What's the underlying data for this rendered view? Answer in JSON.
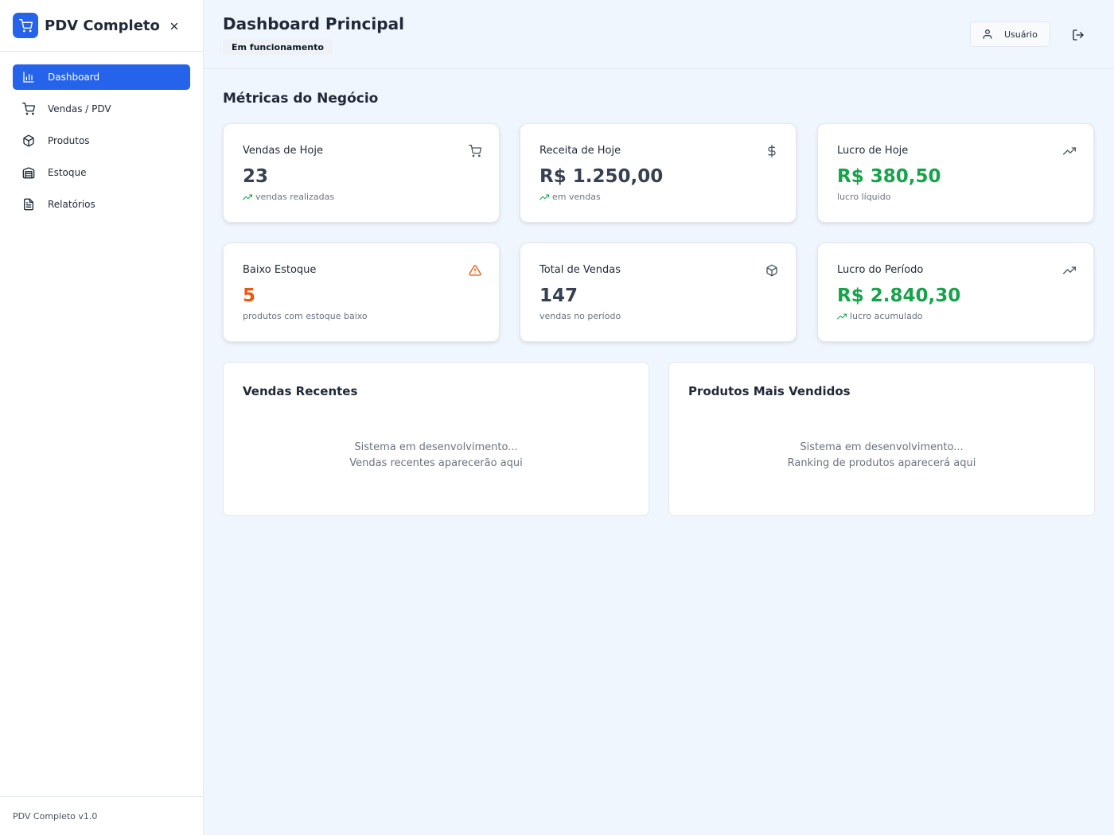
{
  "sidebar": {
    "brand": "PDV Completo",
    "items": [
      {
        "label": "Dashboard",
        "icon": "bar-chart-icon",
        "active": true
      },
      {
        "label": "Vendas / PDV",
        "icon": "cart-icon"
      },
      {
        "label": "Produtos",
        "icon": "package-icon"
      },
      {
        "label": "Estoque",
        "icon": "warehouse-icon"
      },
      {
        "label": "Relatórios",
        "icon": "file-text-icon"
      }
    ],
    "footer": "PDV Completo v1.0"
  },
  "header": {
    "title": "Dashboard Principal",
    "status": "Em funcionamento",
    "user_label": "Usuário"
  },
  "metrics": {
    "title": "Métricas do Negócio",
    "cards": [
      {
        "title": "Vendas de Hoje",
        "value": "23",
        "sub": "vendas realizadas",
        "icon": "cart-icon",
        "trend": true
      },
      {
        "title": "Receita de Hoje",
        "value": "R$ 1.250,00",
        "sub": "em vendas",
        "icon": "dollar-icon",
        "trend": true
      },
      {
        "title": "Lucro de Hoje",
        "value": "R$ 380,50",
        "sub": "lucro líquido",
        "icon": "trending-up-icon",
        "trend": false
      },
      {
        "title": "Baixo Estoque",
        "value": "5",
        "sub": "produtos com estoque baixo",
        "icon": "alert-triangle-icon",
        "trend": false
      },
      {
        "title": "Total de Vendas",
        "value": "147",
        "sub": "vendas no período",
        "icon": "package-icon",
        "trend": false
      },
      {
        "title": "Lucro do Período",
        "value": "R$ 2.840,30",
        "sub": "lucro acumulado",
        "icon": "trending-up-icon",
        "trend": true
      }
    ]
  },
  "panels": [
    {
      "title": "Vendas Recentes",
      "line1": "Sistema em desenvolvimento...",
      "line2": "Vendas recentes aparecerão aqui"
    },
    {
      "title": "Produtos Mais Vendidos",
      "line1": "Sistema em desenvolvimento...",
      "line2": "Ranking de produtos aparecerá aqui"
    }
  ],
  "colors": {
    "primary": "#2563eb",
    "profit_green": "#16a34a",
    "warning_orange": "#ea580c",
    "background": "#f0f6fd"
  }
}
